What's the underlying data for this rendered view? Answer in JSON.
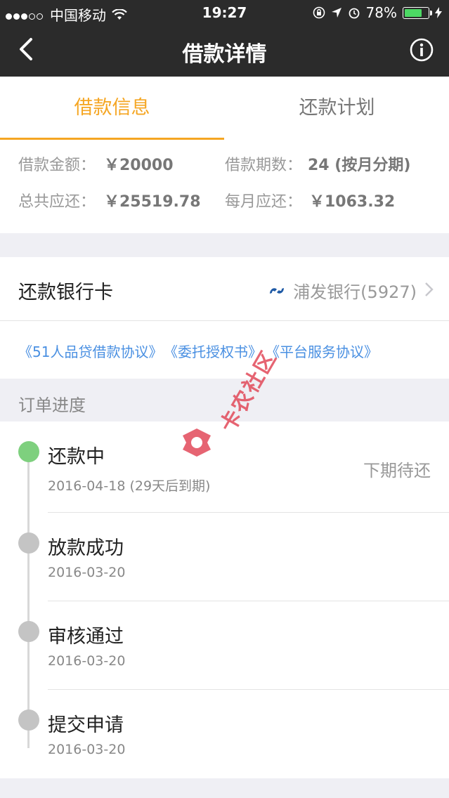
{
  "status_bar": {
    "carrier": "中国移动",
    "time": "19:27",
    "battery": "78%",
    "battery_level": 0.78
  },
  "navbar": {
    "title": "借款详情",
    "back_icon": "chevron-left-icon",
    "info_icon": "info-icon"
  },
  "tabs": [
    {
      "label": "借款信息",
      "active": true
    },
    {
      "label": "还款计划",
      "active": false
    }
  ],
  "loan_info": {
    "amount_label": "借款金额：",
    "amount_value": "￥20000",
    "periods_label": "借款期数：",
    "periods_value": "24 (按月分期)",
    "total_label": "总共应还：",
    "total_value": "￥25519.78",
    "monthly_label": "每月应还：",
    "monthly_value": "￥1063.32"
  },
  "bank_card": {
    "label": "还款银行卡",
    "bank": "浦发银行(5927)",
    "bank_icon": "spdb-logo-icon"
  },
  "protocols": [
    "《51人品贷借款协议》",
    "《委托授权书》",
    "《平台服务协议》"
  ],
  "order_progress": {
    "title": "订单进度",
    "steps": [
      {
        "name": "还款中",
        "date": "2016-04-18 (29天后到期)",
        "status": "下期待还",
        "color": "#7ed07e"
      },
      {
        "name": "放款成功",
        "date": "2016-03-20",
        "status": "",
        "color": "#c4c4c4"
      },
      {
        "name": "审核通过",
        "date": "2016-03-20",
        "status": "",
        "color": "#c4c4c4"
      },
      {
        "name": "提交申请",
        "date": "2016-03-20",
        "status": "",
        "color": "#c4c4c4"
      }
    ]
  },
  "watermark": {
    "text": "卡农社区"
  },
  "colors": {
    "accent": "#f5a623",
    "link": "#4a90e2",
    "header": "#2b2b2b"
  }
}
